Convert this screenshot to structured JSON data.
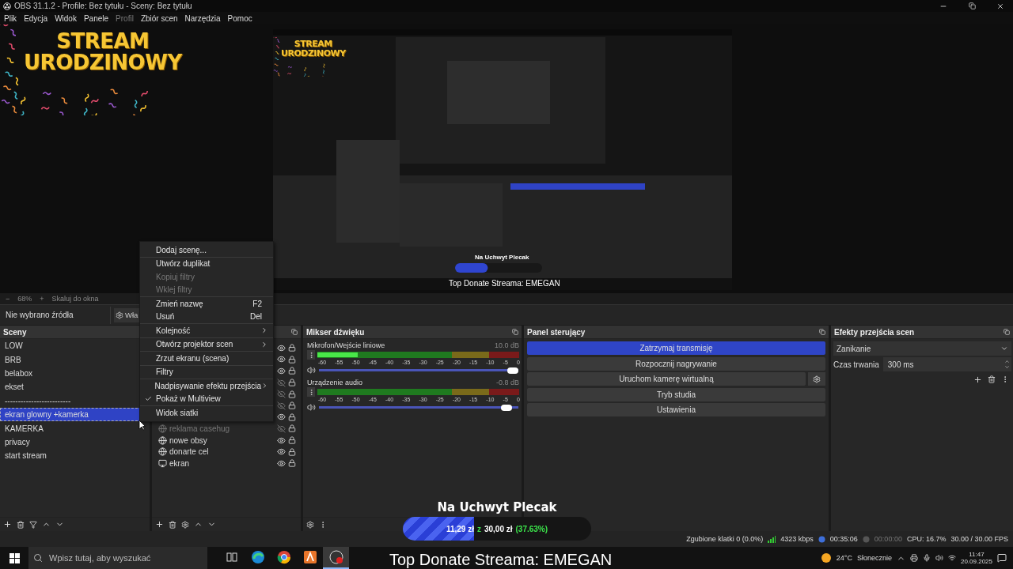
{
  "window": {
    "title": "OBS 31.1.2 - Profile: Bez tytułu - Sceny: Bez tytułu"
  },
  "menu": [
    {
      "label": "Plik",
      "disabled": false
    },
    {
      "label": "Edycja",
      "disabled": false
    },
    {
      "label": "Widok",
      "disabled": false
    },
    {
      "label": "Panele",
      "disabled": false
    },
    {
      "label": "Profil",
      "disabled": true
    },
    {
      "label": "Zbiór scen",
      "disabled": false
    },
    {
      "label": "Narzędzia",
      "disabled": false
    },
    {
      "label": "Pomoc",
      "disabled": false
    }
  ],
  "preview": {
    "banner": [
      "STREAM",
      "URODZINOWY"
    ],
    "captured_screen": {
      "banner": [
        "STREAM",
        "URODZINOWY"
      ],
      "goal_title": "Na Uchwyt Plecak",
      "goal": {
        "level": 0.3763
      },
      "top_donate": "Top Donate Streama: EMEGAN"
    }
  },
  "zoom_bar": {
    "minus": "−",
    "zoom": "68%",
    "plus": "+",
    "fit": "Skaluj do okna"
  },
  "source_bar": {
    "status": "Nie wybrano źródła",
    "properties": "Wła"
  },
  "scenes": {
    "title": "Sceny",
    "items": [
      {
        "name": "LOW",
        "selected": false
      },
      {
        "name": "BRB",
        "selected": false
      },
      {
        "name": "belabox",
        "selected": false
      },
      {
        "name": "ekset",
        "selected": false
      },
      {
        "name": "-------------------------",
        "selected": false
      },
      {
        "name": "ekran glowny +kamerka",
        "selected": true
      },
      {
        "name": "KAMERKA",
        "selected": false
      },
      {
        "name": "privacy",
        "selected": false
      },
      {
        "name": "start stream",
        "selected": false
      }
    ]
  },
  "sources": {
    "items": [
      {
        "visible": true
      },
      {
        "visible": true
      },
      {
        "visible": true
      },
      {
        "visible": false
      },
      {
        "visible": false
      },
      {
        "visible": false
      },
      {
        "visible": true
      },
      {
        "name": "reklama casehug",
        "kind": "browser",
        "visible": false
      },
      {
        "name": "nowe obsy",
        "kind": "browser",
        "visible": true
      },
      {
        "name": "donarte cel",
        "kind": "browser",
        "visible": true
      },
      {
        "name": "ekran",
        "kind": "display",
        "visible": true
      }
    ]
  },
  "mixer": {
    "title": "Mikser dźwięku",
    "channels": [
      {
        "name": "Mikrofon/Wejście liniowe",
        "reading": "10.0 dB",
        "meter": {
          "level": 0.2
        },
        "fader": {
          "level": 1.0
        },
        "scale": [
          "-60",
          "-55",
          "-50",
          "-45",
          "-40",
          "-35",
          "-30",
          "-25",
          "-20",
          "-15",
          "-10",
          "-5",
          "0"
        ]
      },
      {
        "name": "Urządzenie audio",
        "reading": "-0.8 dB",
        "meter": {
          "level": 0
        },
        "fader": {
          "level": 0.97
        },
        "scale": [
          "-60",
          "-55",
          "-50",
          "-45",
          "-40",
          "-35",
          "-30",
          "-25",
          "-20",
          "-15",
          "-10",
          "-5",
          "0"
        ]
      }
    ]
  },
  "controls": {
    "title": "Panel sterujący",
    "buttons": [
      {
        "label": "Zatrzymaj transmisję",
        "active": true,
        "settings": false
      },
      {
        "label": "Rozpocznij nagrywanie",
        "active": false,
        "settings": false
      },
      {
        "label": "Uruchom kamerę wirtualną",
        "active": false,
        "settings": true
      },
      {
        "label": "Tryb studia",
        "active": false,
        "settings": false
      },
      {
        "label": "Ustawienia",
        "active": false,
        "settings": false
      }
    ]
  },
  "transitions": {
    "title": "Efekty przejścia scen",
    "effect": "Zanikanie",
    "duration_label": "Czas trwania",
    "duration": "300 ms"
  },
  "context_menu": {
    "groups": [
      [
        {
          "label": "Dodaj scenę...",
          "disabled": false,
          "submenu": false,
          "checked": false
        }
      ],
      [
        {
          "label": "Utwórz duplikat",
          "disabled": false,
          "submenu": false,
          "checked": false
        },
        {
          "label": "Kopiuj filtry",
          "disabled": true,
          "submenu": false,
          "checked": false
        },
        {
          "label": "Wklej filtry",
          "disabled": true,
          "submenu": false,
          "checked": false
        }
      ],
      [
        {
          "label": "Zmień nazwę",
          "shortcut": "F2",
          "disabled": false,
          "submenu": false,
          "checked": false
        },
        {
          "label": "Usuń",
          "shortcut": "Del",
          "disabled": false,
          "submenu": false,
          "checked": false
        }
      ],
      [
        {
          "label": "Kolejność",
          "disabled": false,
          "submenu": true,
          "checked": false
        }
      ],
      [
        {
          "label": "Otwórz projektor scen",
          "disabled": false,
          "submenu": true,
          "checked": false
        }
      ],
      [
        {
          "label": "Zrzut ekranu (scena)",
          "disabled": false,
          "submenu": false,
          "checked": false
        }
      ],
      [
        {
          "label": "Filtry",
          "disabled": false,
          "submenu": false,
          "checked": false
        }
      ],
      [
        {
          "label": "Nadpisywanie efektu przejścia",
          "disabled": false,
          "submenu": true,
          "checked": false
        },
        {
          "label": "Pokaż w Multiview",
          "disabled": false,
          "submenu": false,
          "checked": true
        }
      ],
      [
        {
          "label": "Widok siatki",
          "disabled": false,
          "submenu": false,
          "checked": false
        }
      ]
    ]
  },
  "goal_overlay": {
    "title": "Na Uchwyt Plecak",
    "raised": "11,29 zł",
    "separator": "z",
    "goal": "30,00 zł",
    "percent": "(37.63%)",
    "level": 0.3763
  },
  "top_donate": "Top Donate Streama: EMEGAN",
  "status_bar": {
    "dropped": "Zgubione klatki 0 (0.0%)",
    "bitrate": "4323 kbps",
    "stream_time": "00:35:06",
    "record_time": "00:00:00",
    "cpu": "CPU: 16.7%",
    "fps": "30.00 / 30.00 FPS"
  },
  "taskbar": {
    "search": {
      "placeholder": "Wpisz tutaj, aby wyszukać"
    },
    "apps": [
      {
        "kind": "taskview",
        "selected": false
      },
      {
        "kind": "edge",
        "selected": false
      },
      {
        "kind": "chrome",
        "selected": false
      },
      {
        "kind": "orange",
        "selected": false
      },
      {
        "kind": "obs",
        "selected": true
      }
    ],
    "temperature": "24°C",
    "weather": "Słonecznie",
    "time": "11:47",
    "date": "20.09.2025"
  }
}
